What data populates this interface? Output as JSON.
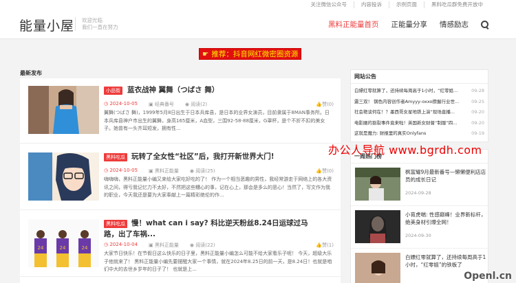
{
  "topbar": {
    "links": [
      "关注微信公众号",
      "内容投诉",
      "示例页面",
      "黑料吃瓜群免费开放中"
    ]
  },
  "header": {
    "logo": "能量小屋",
    "slogan_line1": "欢迎光临",
    "slogan_line2": "我们一直在努力",
    "nav": [
      "黑料正能量首页",
      "正能量分享",
      "情感励志"
    ],
    "active_nav": "黑料正能量首页"
  },
  "banner": {
    "icon": "pointing-hand-icon",
    "text": "推荐：抖音网红微密圈资源"
  },
  "section_title": "最新发布",
  "posts": [
    {
      "category": "小品街",
      "title": "蓝衣战神 翼舞（つばさ 舞）",
      "date": "2024-10-05",
      "author": "经典番号",
      "views": "阅读(2)",
      "likes": "赞(0)",
      "excerpt": "翼舞(つばさ 舞)，1999年5月8日出生于日本兵库县，是日本的业界女演员，目前隶属于8MAN事务所。日本兵库县神户市出生的翼舞，身高165厘米，A血型，三围92-58-88厘米，G罩杯，是个不折不扣的美女子。她曾有一头齐耳短发，拥有性..."
    },
    {
      "category": "黑料吃瓜",
      "title": "玩转了全女性“社区”后，我打开新世界大门!",
      "date": "2024-10-05",
      "author": "黑料正能量",
      "views": "阅读(25)",
      "likes": "赞(0)",
      "excerpt": "嗨嗨嗨，黑料正能量小编又来给大家吃好吃的了！ 作为一个相当恶趣的男性，我经常游走于网络上的各大资讯之间，得亏我记忆力不太好，不然把这些糟心的事，记在心上，那会是多么的恶心！当然了，写文作为我的职业，今天我还是要为大家奉献上一篇精彩绝伦的作..."
    },
    {
      "category": "黑料吃瓜",
      "title": "慢！what can i say? 科比逆天粉丝8.24日运球过马路，出了车祸...",
      "date": "2024-10-04",
      "author": "黑料正能量",
      "views": "阅读(22)",
      "likes": "赞(1)",
      "excerpt": "大家节日快乐！在节假日这么快乐的日子里，黑料正能量小编怎么可能不给大家看乐子呢！ 今天，超级大乐子他就来了！ 黑料正能量小编先要摆醒大家一个事情，就在2024年8.25日的前一天，是8.24日！也就是咱们中大的去世乡岁年的日子了！ 也就是上..."
    }
  ],
  "notices": {
    "title": "网站公告",
    "items": [
      {
        "text": "白嫖红零就算了，还持续每周高于1小时，“红零姐...",
        "date": "09-28"
      },
      {
        "text": "震三双！ 钢色内容创作者Amyyy-oxxo攒握行业世...",
        "date": "09-25"
      },
      {
        "text": "社会艳谈何在！？墨西哥女星地铁上演“现场直播...",
        "date": "09-20"
      },
      {
        "text": "电影圈的割裂事件竟来啦！英国新女财督“制服”四...",
        "date": "09-20"
      },
      {
        "text": "这就是魔力: 财报里的真实Onlyfans",
        "date": "09-19"
      }
    ]
  },
  "weekly": {
    "title": "一周热门榜",
    "items": [
      {
        "title": "枫富耀9月最新番号—懒懒便利店店员的成长日记",
        "date": "2024-09-28"
      },
      {
        "title": "小育虎喘: 性感巅峰！业界新标杆，绝美身材引爆全网！",
        "date": "2024-09-30"
      },
      {
        "title": "白嫖红零就算了，还持续每周高于1小时，“红零姐”的铁板了",
        "date": ""
      }
    ]
  },
  "watermarks": {
    "ad": "办公人导航 www.bgrdh.com",
    "site": "Openl.cn"
  }
}
